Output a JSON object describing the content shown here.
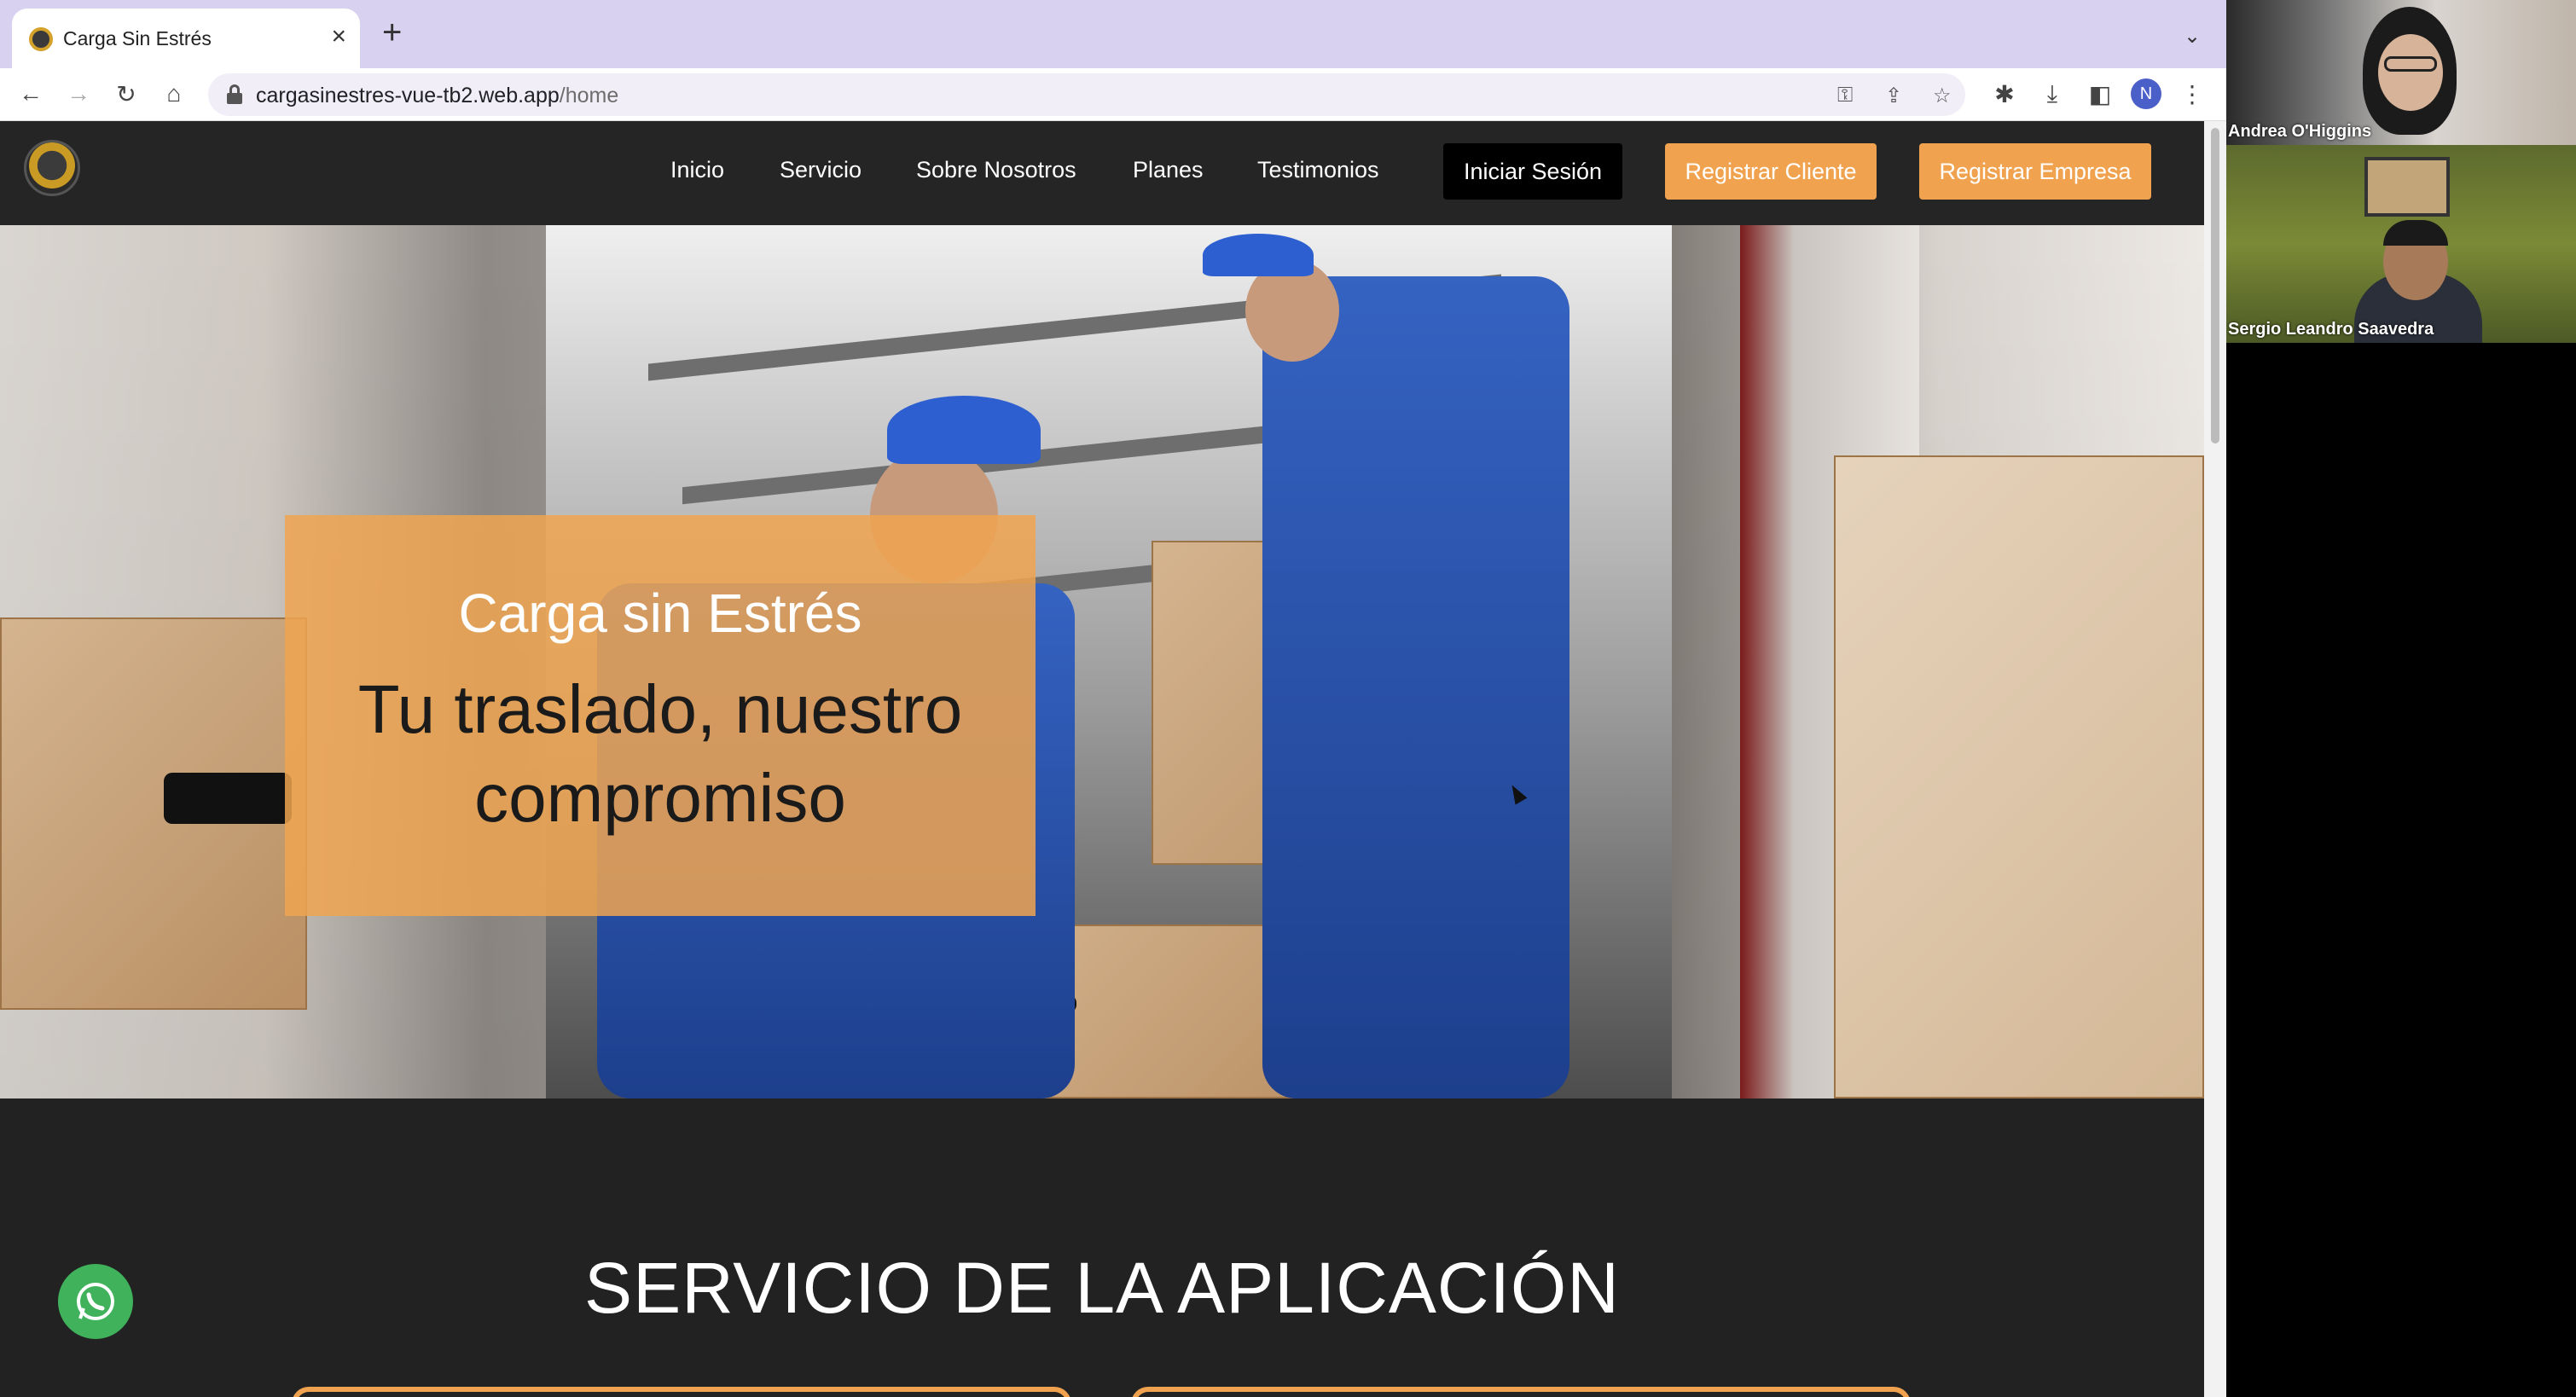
{
  "browser": {
    "tab_title": "Carga Sin Estrés",
    "url_host": "cargasinestres-vue-tb2.web.app",
    "url_path": "/home",
    "profile_initial": "N"
  },
  "navbar": {
    "links": [
      "Inicio",
      "Servicio",
      "Sobre Nosotros",
      "Planes",
      "Testimonios"
    ],
    "login_label": "Iniciar Sesión",
    "register_client_label": "Registrar Cliente",
    "register_company_label": "Registrar Empresa"
  },
  "hero": {
    "title": "Carga sin Estrés",
    "subtitle": "Tu traslado, nuestro compromiso"
  },
  "service": {
    "heading": "SERVICIO DE LA APLICACIÓN"
  },
  "meeting": {
    "participants": [
      {
        "name": "Andrea O'Higgins"
      },
      {
        "name": "Sergio Leandro Saavedra"
      }
    ]
  },
  "colors": {
    "accent_orange": "#f0a24e",
    "navbar_bg": "#252525",
    "whatsapp_green": "#3fb25b"
  }
}
